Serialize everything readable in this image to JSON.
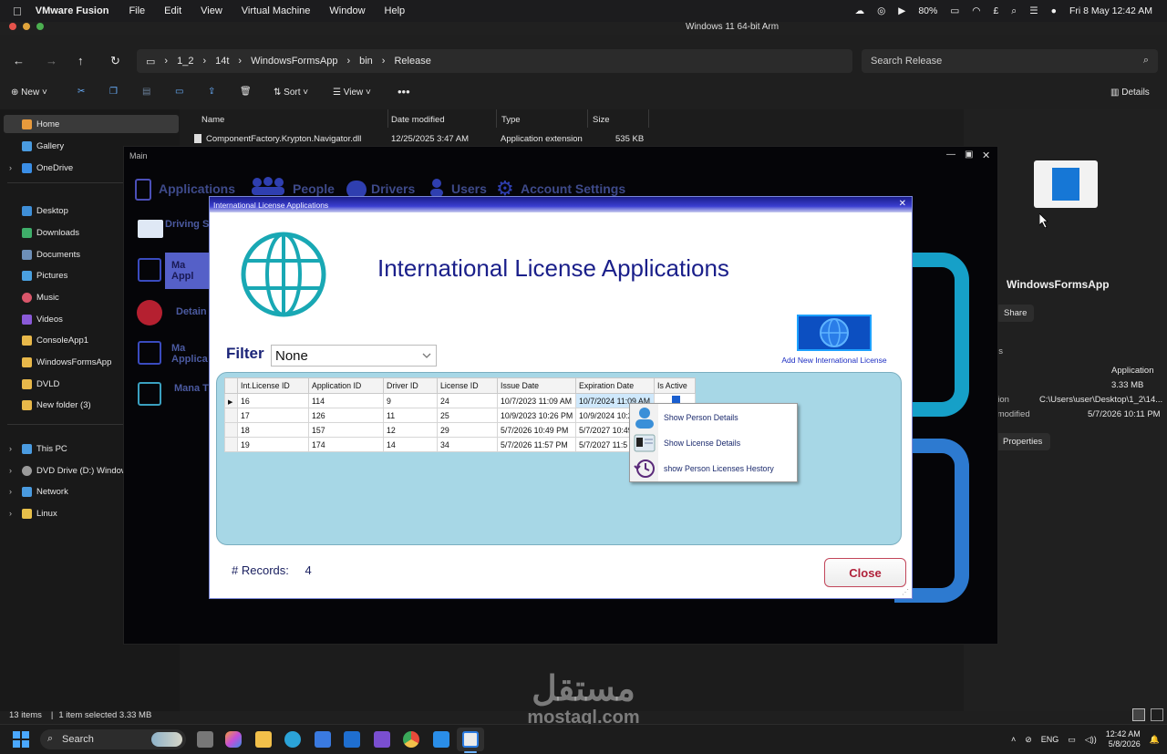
{
  "mac": {
    "app_name": "VMware Fusion",
    "menus": [
      "File",
      "Edit",
      "View",
      "Virtual Machine",
      "Window",
      "Help"
    ],
    "battery": "80%",
    "datetime": "Fri 8 May  12:42 AM",
    "vm_title": "Windows 11 64-bit Arm"
  },
  "explorer": {
    "breadcrumbs": [
      "1_2",
      "14t",
      "WindowsFormsApp",
      "bin",
      "Release"
    ],
    "search_placeholder": "Search Release",
    "toolbar": {
      "new": "New",
      "sort": "Sort",
      "view": "View",
      "details": "Details"
    },
    "sidebar": [
      {
        "label": "Home",
        "color": "#e89a3c"
      },
      {
        "label": "Gallery",
        "color": "#4a9be0"
      },
      {
        "label": "OneDrive",
        "color": "#3a8ee6"
      },
      {
        "label": "Desktop",
        "color": "#3f8fd8"
      },
      {
        "label": "Downloads",
        "color": "#3fae6a"
      },
      {
        "label": "Documents",
        "color": "#6d8fb8"
      },
      {
        "label": "Pictures",
        "color": "#4aa0e0"
      },
      {
        "label": "Music",
        "color": "#d9566a"
      },
      {
        "label": "Videos",
        "color": "#8a5ad8"
      },
      {
        "label": "ConsoleApp1",
        "color": "#e8b84a"
      },
      {
        "label": "WindowsFormsApp",
        "color": "#e8b84a"
      },
      {
        "label": "DVLD",
        "color": "#e8b84a"
      },
      {
        "label": "New folder (3)",
        "color": "#e8b84a"
      },
      {
        "label": "This PC",
        "color": "#4a9be0"
      },
      {
        "label": "DVD Drive (D:) Windows",
        "color": "#9a9a9a"
      },
      {
        "label": "Network",
        "color": "#4a9be0"
      },
      {
        "label": "Linux",
        "color": "#e8c04a"
      }
    ],
    "columns": [
      "Name",
      "Date modified",
      "Type",
      "Size"
    ],
    "file_row": {
      "name": "ComponentFactory.Krypton.Navigator.dll",
      "date": "12/25/2025 3:47 AM",
      "type": "Application extension",
      "size": "535 KB"
    },
    "details": {
      "name": "WindowsFormsApp",
      "share": "Share",
      "section": "Details",
      "type": "Application",
      "size": "3.33 MB",
      "location_label": "Location",
      "location": "C:\\Users\\user\\Desktop\\1_2\\14...",
      "modified_label": "Date modified",
      "modified": "5/7/2026 10:11 PM",
      "properties": "Properties"
    },
    "status": {
      "items": "13 items",
      "selected": "1 item selected  3.33 MB"
    }
  },
  "main_form": {
    "title": "Main",
    "tabs": [
      "Applications",
      "People",
      "Drivers",
      "Users",
      "Account Settings"
    ],
    "side": [
      "Driving Se",
      "Ma Appl",
      "Detain",
      "Ma Applica",
      "Mana T"
    ]
  },
  "dialog": {
    "title": "International License Applications",
    "heading": "International License Applications",
    "filter_label": "Filter",
    "filter_value": "None",
    "add_label": "Add New International License",
    "columns": [
      "Int.License ID",
      "Application ID",
      "Driver ID",
      "License ID",
      "Issue Date",
      "Expiration Date",
      "Is Active"
    ],
    "rows": [
      [
        "16",
        "114",
        "9",
        "24",
        "10/7/2023 11:09 AM",
        "10/7/2024 11:09 AM"
      ],
      [
        "17",
        "126",
        "11",
        "25",
        "10/9/2023 10:26 PM",
        "10/9/2024 10:2"
      ],
      [
        "18",
        "157",
        "12",
        "29",
        "5/7/2026 10:49 PM",
        "5/7/2027 10:49"
      ],
      [
        "19",
        "174",
        "14",
        "34",
        "5/7/2026 11:57 PM",
        "5/7/2027 11:5"
      ]
    ],
    "records_label": "# Records:",
    "records_count": "4",
    "close_label": "Close"
  },
  "context_menu": [
    "Show Person Details",
    "Show License Details",
    "show Person Licenses Hestory"
  ],
  "taskbar": {
    "search": "Search",
    "lang": "ENG",
    "time": "12:42 AM",
    "date": "5/8/2026"
  },
  "watermark": {
    "arabic": "مستقل",
    "latin": "mostaql.com"
  }
}
